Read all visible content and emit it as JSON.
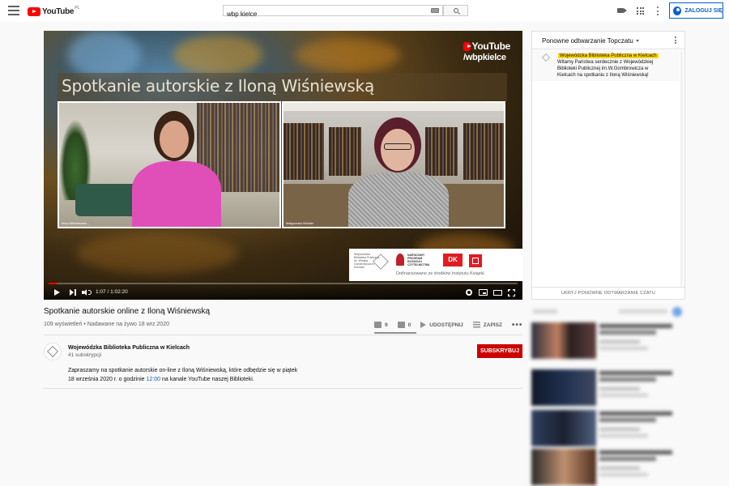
{
  "header": {
    "logo_text": "YouTube",
    "logo_country": "PL",
    "search_value": "wbp kielce",
    "signin_label": "ZALOGUJ SIĘ"
  },
  "player": {
    "slide_title": "Spotkanie autorskie z Iloną Wiśniewską",
    "channel_logo_line1": "YouTube",
    "channel_logo_line2": "/wbpkielce",
    "cam1_label": "Ilona Wiśniewska ...",
    "cam2_label": "Małgorzata Winkler",
    "sponsor_library": "Wojewódzka Biblioteka Publiczna im. Witolda Gombrowicza w Kielcach",
    "sponsor_program": "NARODOWY PROGRAM ROZWOJU CZYTELNICTWA",
    "sponsor_dk": "DK",
    "sponsor_funding": "Dofinansowano ze środków Instytutu Książki.",
    "time": "1:07 / 1:02:20",
    "progress_fraction": 0.018
  },
  "video": {
    "title": "Spotkanie autorskie online z Iloną Wiśniewską",
    "meta": "109 wyświetleń • Nadawane na żywo 18 wrz 2020",
    "likes": "9",
    "dislikes": "0",
    "share_label": "UDOSTĘPNIJ",
    "save_label": "ZAPISZ",
    "more_label": "•••"
  },
  "channel": {
    "name": "Wojewódzka Biblioteka Publiczna w Kielcach",
    "subs": "41 subskrypcji",
    "subscribe_label": "SUBSKRYBUJ"
  },
  "description": {
    "part1": "Zapraszamy na spotkanie autorskie on-line z Iloną Wiśniewską, które odbędzie się w piątek 18 września 2020 r. o godzinie ",
    "time_link": "12:00",
    "part2": " na kanale YouTube naszej Biblioteki."
  },
  "chat": {
    "header": "Ponowne odtwarzanie Topczatu",
    "messages": [
      {
        "author": "Wojewódzka Biblioteka Publiczna w Kielcach",
        "text": "Witamy Państwa serdecznie z Wojewódzkiej Biblioteki Publicznej im.W.Gombrowicza w Kielcach na spotkaniu z Iloną Wiśniewską!"
      }
    ],
    "footer": "UKRYJ PONOWNE ODTWARZANIE CZATU"
  },
  "colors": {
    "brand_red": "#ff0000",
    "link_blue": "#065fd4",
    "subscribe_red": "#cc0000",
    "author_highlight": "#ffd600"
  }
}
